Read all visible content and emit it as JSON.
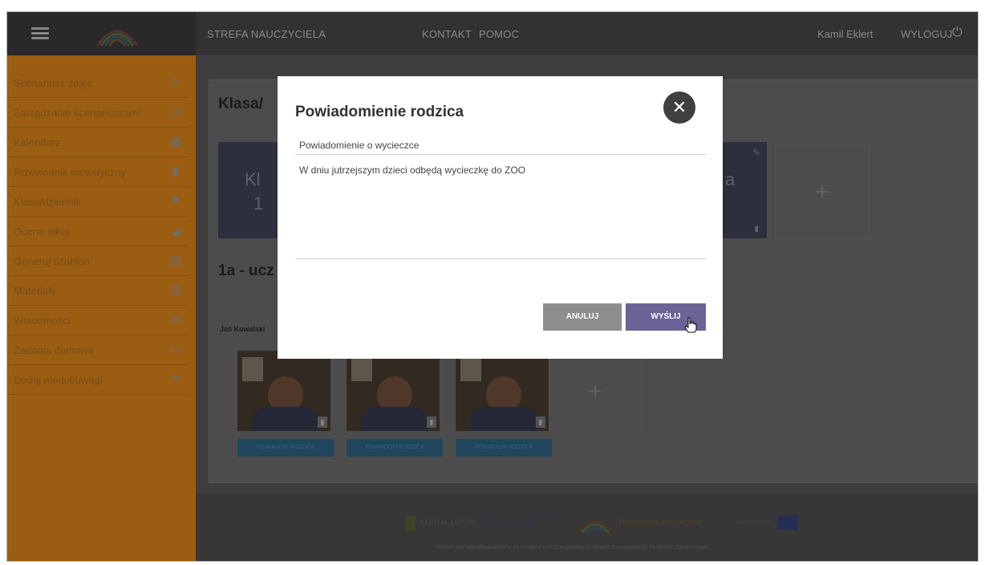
{
  "header": {
    "nav": [
      "STREFA NAUCZYCIELA",
      "KONTAKT",
      "POMOC"
    ],
    "user_name": "Kamil Eklert",
    "logout_label": "WYLOGUJ"
  },
  "sidebar": {
    "items": [
      {
        "label": "Scenariusz zajęć",
        "icon": "edit-icon"
      },
      {
        "label": "Zarządzanie scenariuszami",
        "icon": "clock-icon"
      },
      {
        "label": "Kalendarz",
        "icon": "calendar-icon"
      },
      {
        "label": "Przewodnik metodyczny",
        "icon": "book-icon"
      },
      {
        "label": "Klasa/dziennik",
        "icon": "journal-icon"
      },
      {
        "label": "Ocena lekcji",
        "icon": "chart-icon"
      },
      {
        "label": "Generuj szablon",
        "icon": "template-icon"
      },
      {
        "label": "Materiały",
        "icon": "film-icon"
      },
      {
        "label": "Wiadomości",
        "icon": "mail-icon"
      },
      {
        "label": "Zadania domowe",
        "icon": "homework-icon"
      },
      {
        "label": "Dodaj moduł/uwagi",
        "icon": "note-icon"
      }
    ]
  },
  "main": {
    "class_title": "Klasa/",
    "class_tiles": [
      {
        "line1": "Kl",
        "line2": "1"
      },
      {
        "line1": "a",
        "line2": ""
      }
    ],
    "add_symbol": "+",
    "section_title": "1a - ucz",
    "student_label": "Jaś Kowalski",
    "notify_label": "POWIADOM RODZICA"
  },
  "modal": {
    "title": "Powiadomienie rodzica",
    "close_symbol": "✕",
    "subject": "Powiadomienie o wycieczce",
    "body": "W dniu jutrzejszym dzieci odbędą wycieczkę do ZOO",
    "cancel_label": "ANULUJ",
    "send_label": "WYŚLIJ"
  },
  "footer": {
    "partners": [
      "KAPITAŁ LUDZKI",
      "LANDER'S",
      "Trampolina do sukcesu",
      "UNIA EUROPEJSKA"
    ],
    "note": "Projekt jest współfinansowany ze środków Unii Europejskiej w ramach Europejskiego Funduszu Społecznego"
  },
  "colors": {
    "sidebar": "#b06a14",
    "topbar": "#3a3a3a",
    "send_button": "#6b6396",
    "cancel_button": "#8e8e8e"
  }
}
